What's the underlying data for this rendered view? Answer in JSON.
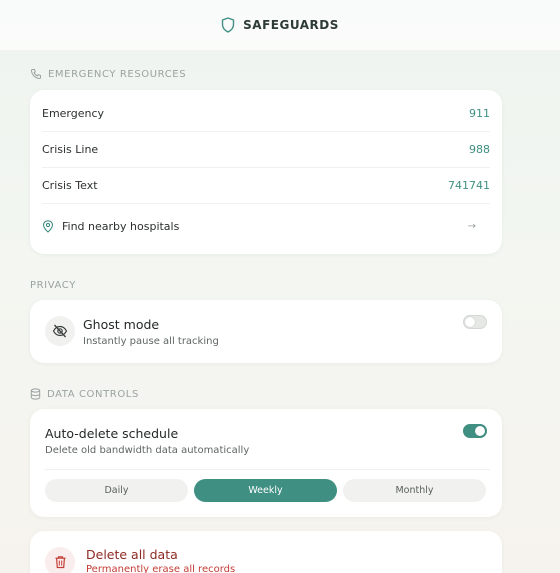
{
  "header": {
    "title": "SAFEGUARDS",
    "icon": "shield-icon"
  },
  "emergency": {
    "label": "EMERGENCY RESOURCES",
    "icon": "phone-icon",
    "rows": [
      {
        "name": "Emergency",
        "value": "911"
      },
      {
        "name": "Crisis Line",
        "value": "988"
      },
      {
        "name": "Crisis Text",
        "value": "741741"
      }
    ],
    "hospitals": {
      "label": "Find nearby hospitals",
      "icon": "map-pin-icon",
      "arrow": "→"
    }
  },
  "privacy": {
    "label": "PRIVACY",
    "ghost": {
      "title": "Ghost mode",
      "subtitle": "Instantly pause all tracking",
      "icon": "eye-off-icon",
      "enabled": false
    }
  },
  "data_controls": {
    "label": "DATA CONTROLS",
    "icon": "database-icon",
    "auto_delete": {
      "title": "Auto-delete schedule",
      "subtitle": "Delete old bandwidth data automatically",
      "enabled": true,
      "options": [
        "Daily",
        "Weekly",
        "Monthly"
      ],
      "selected": "Weekly"
    },
    "delete_all": {
      "title": "Delete all data",
      "subtitle": "Permanently erase all records",
      "icon": "trash-icon"
    }
  },
  "colors": {
    "accent": "#3f8f82",
    "danger": "#c43c35",
    "danger_dark": "#8e2a24"
  }
}
